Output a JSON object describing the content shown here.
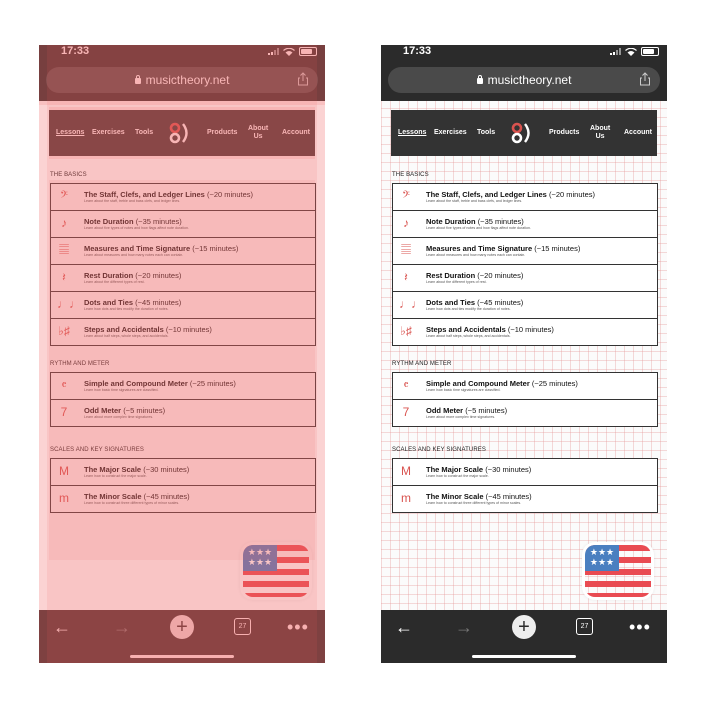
{
  "status": {
    "time": "17:33"
  },
  "browser": {
    "url": "musictheory.net",
    "tab_count": "27"
  },
  "nav": {
    "lessons": "Lessons",
    "exercises": "Exercises",
    "tools": "Tools",
    "products": "Products",
    "about": "About Us",
    "account": "Account"
  },
  "sections": [
    {
      "title": "THE BASICS",
      "items": [
        {
          "icon": "bass-clef-icon",
          "name": "The Staff, Clefs, and Ledger Lines",
          "duration": "(~20 minutes)",
          "desc": "Learn about the staff, treble and bass clefs, and ledger lines."
        },
        {
          "icon": "eighth-note-icon",
          "name": "Note Duration",
          "duration": "(~35 minutes)",
          "desc": "Learn about five types of notes and how flags affect note duration."
        },
        {
          "icon": "measure-icon",
          "name": "Measures and Time Signature",
          "duration": "(~15 minutes)",
          "desc": "Learn about measures and how many notes each can contain."
        },
        {
          "icon": "rest-icon",
          "name": "Rest Duration",
          "duration": "(~20 minutes)",
          "desc": "Learn about the different types of rest."
        },
        {
          "icon": "tied-notes-icon",
          "name": "Dots and Ties",
          "duration": "(~45 minutes)",
          "desc": "Learn how dots and ties modify the duration of notes."
        },
        {
          "icon": "accidentals-icon",
          "name": "Steps and Accidentals",
          "duration": "(~10 minutes)",
          "desc": "Learn about half steps, whole steps, and accidentals."
        }
      ]
    },
    {
      "title": "RYTHM AND METER",
      "items": [
        {
          "icon": "time-signature-icon",
          "name": "Simple and Compound Meter",
          "duration": "(~25 minutes)",
          "desc": "Learn how basic time signatures are classified."
        },
        {
          "icon": "odd-meter-icon",
          "name": "Odd Meter",
          "duration": "(~5 minutes)",
          "desc": "Learn about more complex time signatures."
        }
      ]
    },
    {
      "title": "SCALES AND KEY SIGNATURES",
      "items": [
        {
          "icon": "major-scale-icon",
          "name": "The Major Scale",
          "duration": "(~30 minutes)",
          "desc": "Learn how to construct the major scale."
        },
        {
          "icon": "minor-scale-icon",
          "name": "The Minor Scale",
          "duration": "(~45 minutes)",
          "desc": "Learn how to construct three different types of minor scales."
        }
      ]
    }
  ],
  "colors": {
    "accent": "#d9534f",
    "chrome": "#2b2b2b",
    "header": "#333333",
    "overlay": "#f06060"
  }
}
